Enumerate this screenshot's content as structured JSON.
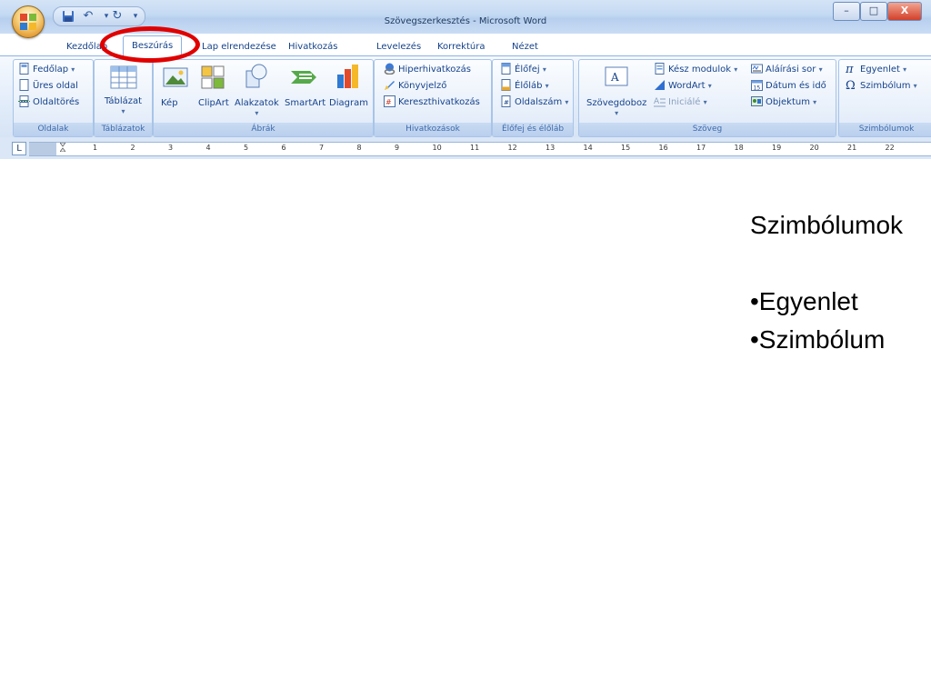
{
  "window": {
    "title": "Szövegszerkesztés - Microsoft Word",
    "controls": {
      "minimize": "–",
      "maximize": "□",
      "close": "X"
    }
  },
  "quick_access": {
    "save": "save-icon",
    "undo": "↶",
    "redo": "↻",
    "more": "▾"
  },
  "tabs": [
    {
      "label": "Kezdőlap"
    },
    {
      "label": "Beszúrás"
    },
    {
      "label": "Lap elrendezése"
    },
    {
      "label": "Hivatkozás"
    },
    {
      "label": "Levelezés"
    },
    {
      "label": "Korrektúra"
    },
    {
      "label": "Nézet"
    }
  ],
  "groups": {
    "oldalak": {
      "label": "Oldalak",
      "items": [
        "Fedőlap",
        "Üres oldal",
        "Oldaltörés"
      ]
    },
    "tablazatok": {
      "label": "Táblázatok",
      "items": [
        "Táblázat"
      ]
    },
    "abrak": {
      "label": "Ábrák",
      "items": [
        "Kép",
        "ClipArt",
        "Alakzatok",
        "SmartArt",
        "Diagram"
      ]
    },
    "hivatkozasok": {
      "label": "Hivatkozások",
      "items": [
        "Hiperhivatkozás",
        "Könyvjelző",
        "Kereszthivatkozás"
      ]
    },
    "elofej": {
      "label": "Élőfej és élőláb",
      "items": [
        "Élőfej",
        "Élőláb",
        "Oldalszám"
      ]
    },
    "szoveg": {
      "label": "Szöveg",
      "items": [
        "Szövegdoboz",
        "Kész modulok",
        "WordArt",
        "Iniciálé",
        "Aláírási sor",
        "Dátum és idő",
        "Objektum"
      ]
    },
    "szimbolumok": {
      "label": "Szimbólumok",
      "items": [
        "Egyenlet",
        "Szimbólum"
      ]
    }
  },
  "ruler": {
    "corner": "L",
    "ticks": [
      "1",
      "2",
      "3",
      "4",
      "5",
      "6",
      "7",
      "8",
      "9",
      "10",
      "11",
      "12",
      "13",
      "14",
      "15",
      "16",
      "17",
      "18",
      "19",
      "20",
      "21",
      "22"
    ]
  },
  "slide": {
    "title": "Szimbólumok",
    "bullets": [
      "•Egyenlet",
      "•Szimbólum"
    ]
  }
}
